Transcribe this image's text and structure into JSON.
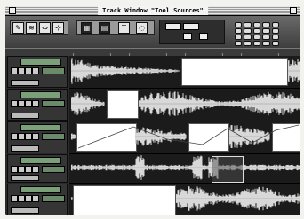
{
  "window": {
    "title": "Track Window \"Tool Sources\""
  },
  "toolbar": {
    "tools": [
      {
        "name": "pencil-tool",
        "glyph": "✎"
      },
      {
        "name": "scrub-tool",
        "glyph": "≋"
      },
      {
        "name": "trim-tool",
        "glyph": "⇔"
      },
      {
        "name": "select-tool",
        "glyph": "⊹"
      }
    ],
    "icons": [
      {
        "name": "floppy-icon",
        "glyph": "▦"
      },
      {
        "name": "trash-icon",
        "glyph": "▤"
      },
      {
        "name": "text-tool-icon",
        "glyph": "T"
      },
      {
        "name": "loop-icon",
        "glyph": "◌"
      }
    ],
    "labels": [
      "",
      "",
      "",
      ""
    ]
  },
  "tracks": [
    {
      "name": "",
      "sub": ""
    },
    {
      "name": "",
      "sub": ""
    },
    {
      "name": "",
      "sub": ""
    },
    {
      "name": "",
      "sub": ""
    },
    {
      "name": "",
      "sub": ""
    }
  ],
  "colors": {
    "waveform": "#d8d8d8",
    "selection": "#ffffff",
    "trackName": "#7aa07a"
  }
}
